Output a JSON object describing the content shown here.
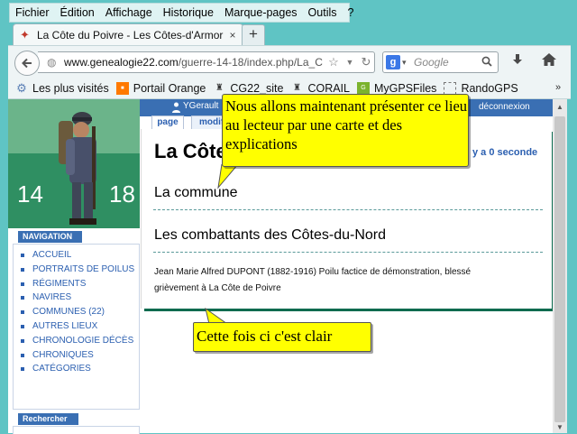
{
  "menu": [
    "Fichier",
    "Édition",
    "Affichage",
    "Historique",
    "Marque-pages",
    "Outils",
    "?"
  ],
  "tab": {
    "title": "La Côte du Poivre - Les Côtes-d'Armor d...",
    "close": "×",
    "new_tab": "+"
  },
  "address": {
    "host": "www.genealogie22.com",
    "path": "/guerre-14-18/index.php/La_C"
  },
  "search": {
    "engine": "g",
    "placeholder": "Google"
  },
  "bookmarks": [
    {
      "label": "Les plus visités",
      "icon": "gear-icon",
      "color": "#5a7fb5"
    },
    {
      "label": "Portail Orange",
      "icon": "orange-icon",
      "color": "#ff7900"
    },
    {
      "label": "CG22_site",
      "icon": "crest-icon",
      "color": "#3a3a3a"
    },
    {
      "label": "CORAIL",
      "icon": "crest-icon",
      "color": "#3a3a3a"
    },
    {
      "label": "MyGPSFiles",
      "icon": "gps-icon",
      "color": "#7bb32e"
    },
    {
      "label": "RandoGPS",
      "icon": "page-icon",
      "color": "#ffffff"
    }
  ],
  "bookmarks_more": "»",
  "site": {
    "banner_left": "14",
    "banner_right": "18",
    "user": "YGerault",
    "logout": "déconnexion",
    "tabs": {
      "page": "page",
      "modify": "modifier"
    },
    "nav_title": "NAVIGATION",
    "nav": [
      "ACCUEIL",
      "PORTRAITS DE POILUS",
      "RÉGIMENTS",
      "NAVIRES",
      "COMMUNES (22)",
      "AUTRES LIEUX",
      "CHRONOLOGIE DÉCÈS",
      "CHRONIQUES",
      "CATÉGORIES"
    ],
    "search_title": "Rechercher"
  },
  "content": {
    "title": "La Côte du Poivre",
    "ago": "y a 0 seconde",
    "section1": "La commune",
    "section2": "Les combattants des Côtes-du-Nord",
    "soldier": "Jean Marie Alfred DUPONT (1882-1916) Poilu factice de démonstration, blessé grièvement à La Côte de Poivre"
  },
  "callouts": {
    "top": "Nous allons maintenant présenter ce lieu au lecteur par une carte et des explications",
    "bottom": "Cette fois ci c'est clair"
  }
}
